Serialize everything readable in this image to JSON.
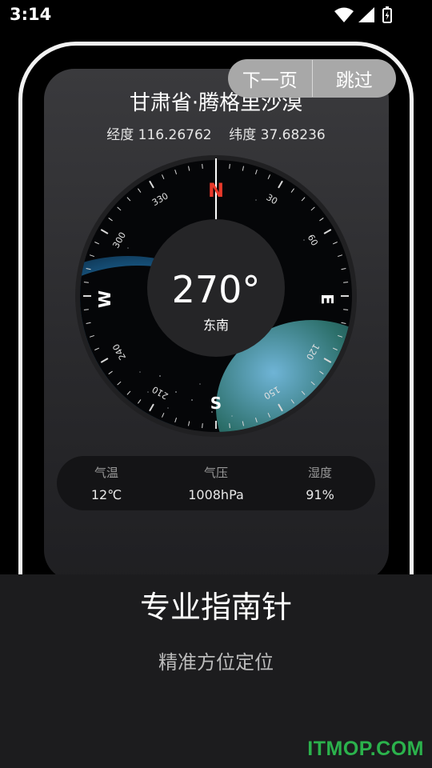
{
  "status_bar": {
    "time": "3:14",
    "icons": [
      "wifi-icon",
      "signal-icon",
      "battery-icon"
    ]
  },
  "nav": {
    "next_label": "下一页",
    "skip_label": "跳过"
  },
  "location": {
    "name": "甘肃省·腾格里沙漠",
    "longitude_label": "经度",
    "longitude": "116.26762",
    "latitude_label": "纬度",
    "latitude": "37.68236"
  },
  "compass": {
    "heading": "270°",
    "direction": "东南",
    "cardinals": {
      "n": "N",
      "e": "E",
      "s": "S",
      "w": "W"
    },
    "degree_labels": [
      "30",
      "60",
      "120",
      "150",
      "210",
      "240",
      "300",
      "330"
    ],
    "north_color": "#e8392a"
  },
  "weather": [
    {
      "label": "气温",
      "value": "12℃"
    },
    {
      "label": "气压",
      "value": "1008hPa"
    },
    {
      "label": "湿度",
      "value": "91%"
    }
  ],
  "feature": {
    "title": "专业指南针",
    "subtitle": "精准方位定位"
  },
  "watermark": "ITMOP.COM"
}
